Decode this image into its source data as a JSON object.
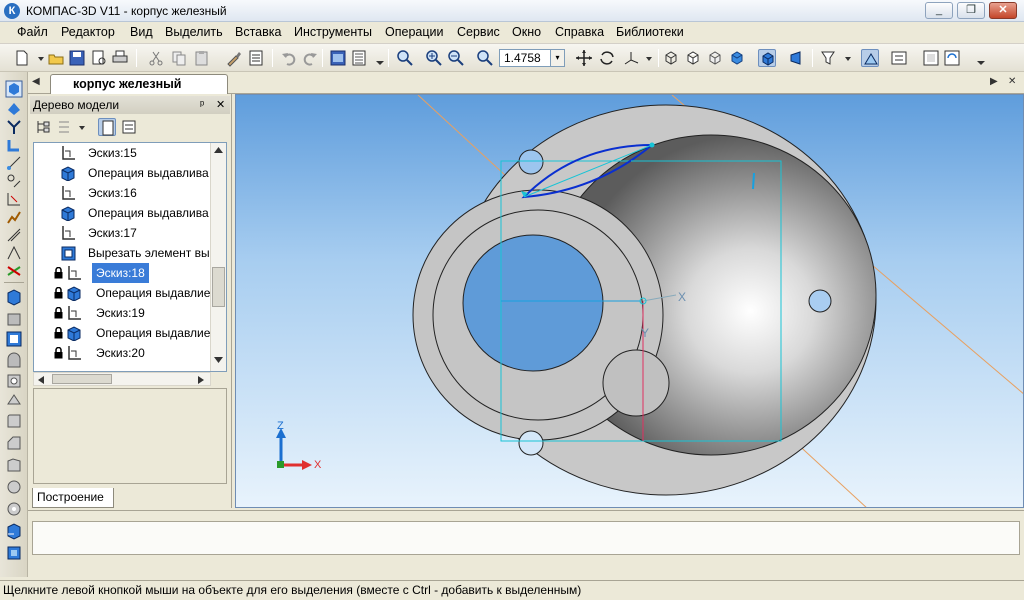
{
  "window": {
    "title": "КОМПАС-3D V11 - корпус железный",
    "icon_letter": "К",
    "minimize_label": "_",
    "restore_label": "❐",
    "close_label": "✕"
  },
  "menu": [
    "Файл",
    "Редактор",
    "Вид",
    "Выделить",
    "Вставка",
    "Инструменты",
    "Операции",
    "Сервис",
    "Окно",
    "Справка",
    "Библиотеки"
  ],
  "toolbar": {
    "zoom_value": "1.4758",
    "zoom_dropdown": "▾"
  },
  "document_tab": {
    "label": "корпус железный",
    "left_arrow": "◀",
    "right_arrow": "▶",
    "close": "✕"
  },
  "model_tree": {
    "title": "Дерево модели",
    "pin": "ᵖ",
    "close": "✕",
    "items": [
      {
        "label": "Эскиз:15",
        "type": "sketch",
        "locked": false,
        "selected": false
      },
      {
        "label": "Операция выдавлива",
        "type": "extrude",
        "locked": false,
        "selected": false
      },
      {
        "label": "Эскиз:16",
        "type": "sketch",
        "locked": false,
        "selected": false
      },
      {
        "label": "Операция выдавлива",
        "type": "extrude",
        "locked": false,
        "selected": false
      },
      {
        "label": "Эскиз:17",
        "type": "sketch",
        "locked": false,
        "selected": false
      },
      {
        "label": "Вырезать элемент вы",
        "type": "cut",
        "locked": false,
        "selected": false
      },
      {
        "label": "Эскиз:18",
        "type": "sketch",
        "locked": true,
        "selected": true
      },
      {
        "label": "Операция выдавлие",
        "type": "extrude",
        "locked": true,
        "selected": false
      },
      {
        "label": "Эскиз:19",
        "type": "sketch",
        "locked": true,
        "selected": false
      },
      {
        "label": "Операция выдавлие",
        "type": "extrude",
        "locked": true,
        "selected": false
      },
      {
        "label": "Эскиз:20",
        "type": "sketch",
        "locked": true,
        "selected": false
      }
    ],
    "bottom_tab": "Построение"
  },
  "viewport": {
    "axis_x_label": "X",
    "axis_y_label": "Y",
    "axis_z_label": "Z",
    "triad_x_label": "X",
    "triad_z_label": "Z"
  },
  "status": {
    "message": "Щелкните левой кнопкой мыши на объекте для его выделения (вместе с Ctrl - добавить к выделенным)"
  },
  "colors": {
    "selection": "#3a7cd8",
    "sketch_blue": "#0a2fd0",
    "construction_orange": "#e8a060",
    "projection_cyan": "#17c4d6",
    "axis_red": "#e03030"
  }
}
